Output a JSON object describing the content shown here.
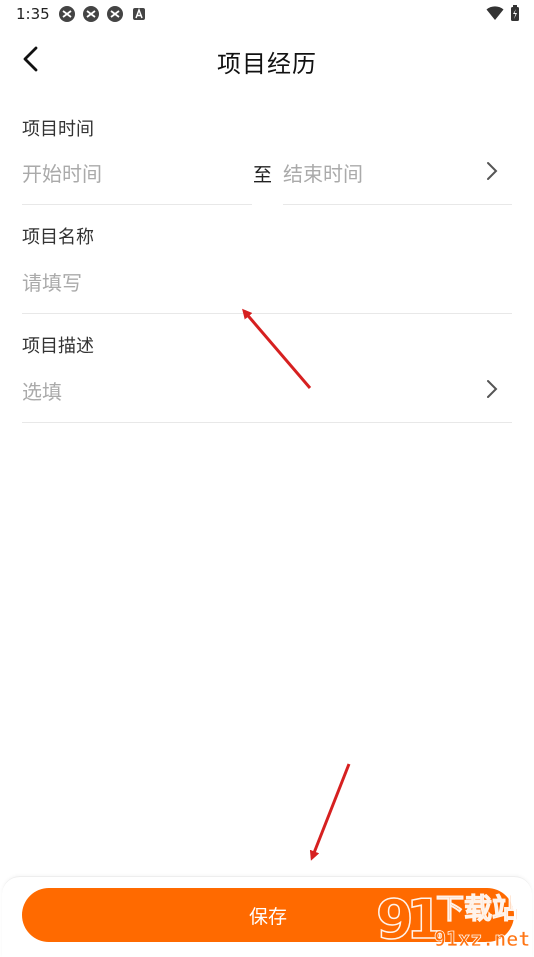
{
  "status_bar": {
    "time": "1:35"
  },
  "header": {
    "title": "项目经历"
  },
  "form": {
    "project_time": {
      "label": "项目时间",
      "start_placeholder": "开始时间",
      "to": "至",
      "end_placeholder": "结束时间"
    },
    "project_name": {
      "label": "项目名称",
      "placeholder": "请填写"
    },
    "project_desc": {
      "label": "项目描述",
      "placeholder": "选填"
    }
  },
  "footer": {
    "save_label": "保存"
  },
  "watermark": {
    "title": "下载站",
    "site": "91xz.net"
  },
  "colors": {
    "accent": "#ff6a00",
    "annotation_arrow": "#d62020"
  }
}
